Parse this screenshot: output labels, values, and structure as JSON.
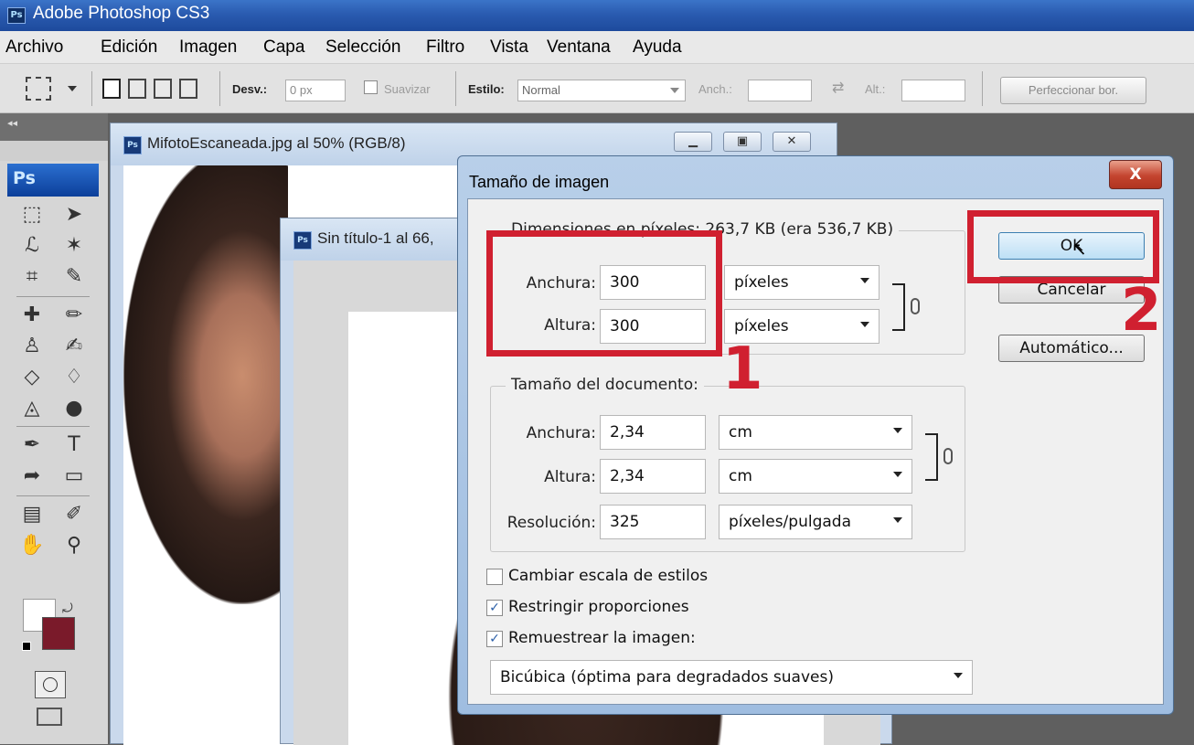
{
  "app": {
    "title": "Adobe Photoshop CS3",
    "icon": "Ps"
  },
  "menu": [
    "Archivo",
    "Edición",
    "Imagen",
    "Capa",
    "Selección",
    "Filtro",
    "Vista",
    "Ventana",
    "Ayuda"
  ],
  "options": {
    "feather_label": "Desv.:",
    "feather_value": "0 px",
    "antialias_label": "Suavizar",
    "style_label": "Estilo:",
    "style_value": "Normal",
    "width_label": "Anch.:",
    "height_label": "Alt.:",
    "refine_button": "Perfeccionar bor."
  },
  "toolbox": {
    "logo": "Ps",
    "collapse": "◂◂"
  },
  "documents": [
    {
      "title": "MifotoEscaneada.jpg al 50% (RGB/8)"
    },
    {
      "title": "Sin título-1 al 66,"
    }
  ],
  "dialog": {
    "title": "Tamaño de imagen",
    "close": "X",
    "pixel_group": {
      "label": "Dimensiones en píxeles: 263,7 KB (era 536,7 KB)",
      "width_label": "Anchura:",
      "width_value": "300",
      "width_unit": "píxeles",
      "height_label": "Altura:",
      "height_value": "300",
      "height_unit": "píxeles"
    },
    "doc_group": {
      "label": "Tamaño del documento:",
      "width_label": "Anchura:",
      "width_value": "2,34",
      "width_unit": "cm",
      "height_label": "Altura:",
      "height_value": "2,34",
      "height_unit": "cm",
      "res_label": "Resolución:",
      "res_value": "325",
      "res_unit": "píxeles/pulgada"
    },
    "checkboxes": [
      {
        "label": "Cambiar escala de estilos",
        "checked": false
      },
      {
        "label": "Restringir proporciones",
        "checked": true
      },
      {
        "label": "Remuestrear la imagen:",
        "checked": true
      }
    ],
    "resample_method": "Bicúbica (óptima para degradados suaves)",
    "buttons": {
      "ok": "OK",
      "cancel": "Cancelar",
      "auto": "Automático..."
    }
  },
  "annotations": {
    "step1": "1",
    "step2": "2"
  },
  "colors": {
    "accent_red": "#d02030",
    "foreground": "#ffffff",
    "background": "#7a1a2a"
  }
}
